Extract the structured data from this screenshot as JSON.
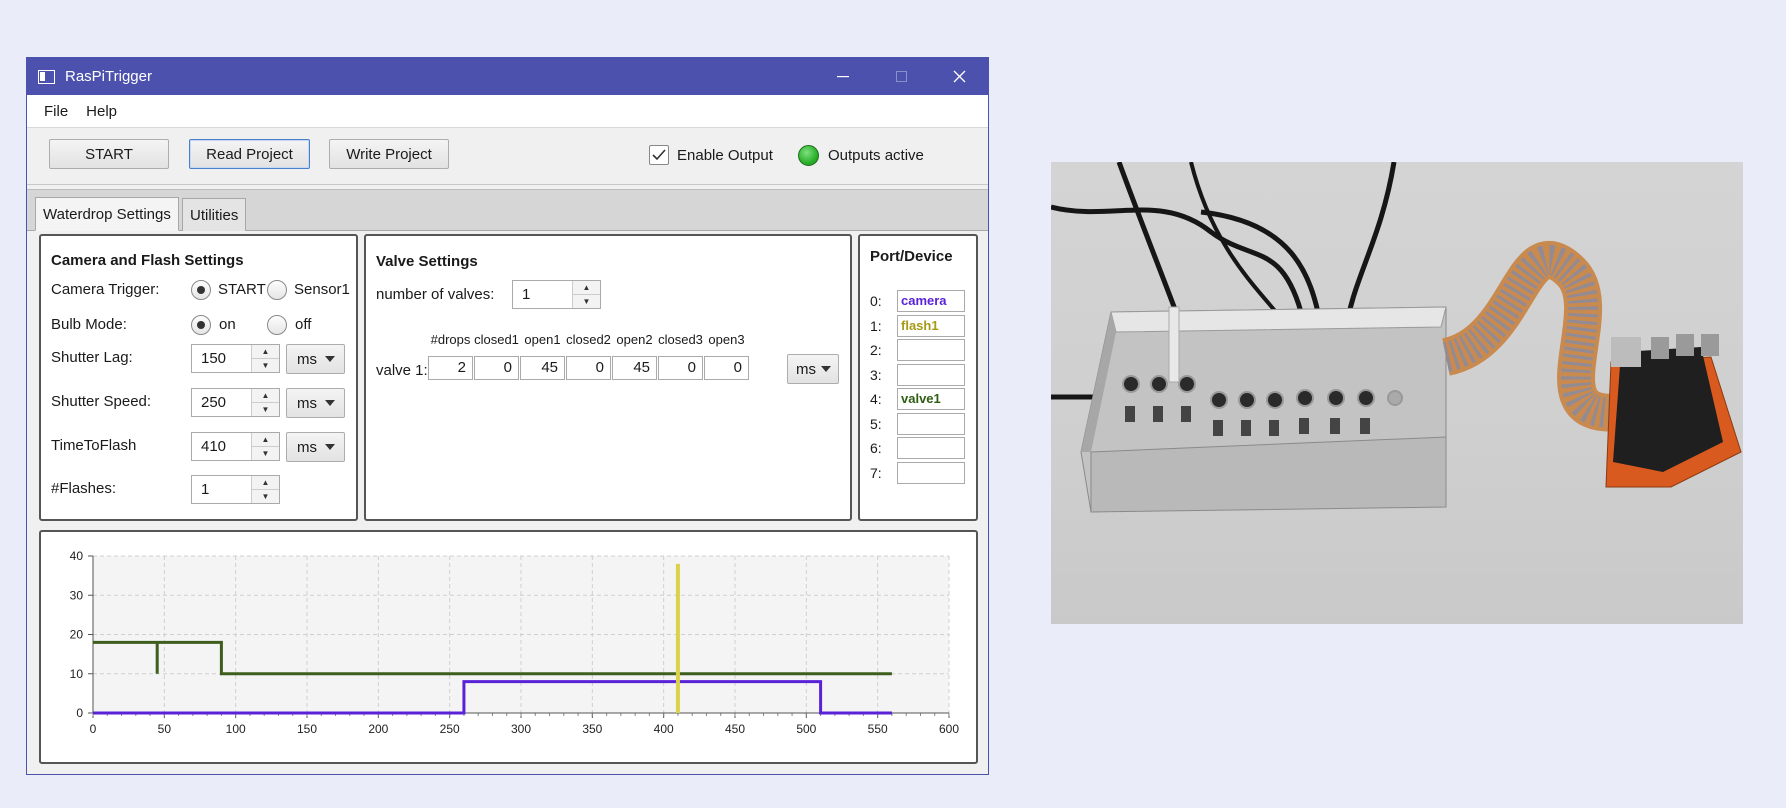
{
  "window": {
    "title": "RasPiTrigger",
    "controls": {
      "minimize": "—",
      "maximize": "☐",
      "close": "✕"
    }
  },
  "menu": [
    "File",
    "Help"
  ],
  "toolbar": {
    "start_label": "START",
    "read_label": "Read Project",
    "write_label": "Write Project",
    "enable_output_label": "Enable Output",
    "enable_output_checked": true,
    "outputs_active_label": "Outputs active",
    "led_color": "#2bb12b"
  },
  "tabs": [
    "Waterdrop Settings",
    "Utilities"
  ],
  "camera": {
    "title": "Camera and Flash Settings",
    "trigger_label": "Camera Trigger:",
    "trigger_options": [
      "START",
      "Sensor1"
    ],
    "trigger_selected": "START",
    "bulb_label": "Bulb Mode:",
    "bulb_options": [
      "on",
      "off"
    ],
    "bulb_selected": "on",
    "shutter_lag_label": "Shutter Lag:",
    "shutter_lag": "150",
    "shutter_lag_unit": "ms",
    "shutter_speed_label": "Shutter Speed:",
    "shutter_speed": "250",
    "shutter_speed_unit": "ms",
    "time_to_flash_label": "TimeToFlash",
    "time_to_flash": "410",
    "time_to_flash_unit": "ms",
    "flashes_label": "#Flashes:",
    "flashes": "1"
  },
  "valve": {
    "title": "Valve Settings",
    "num_label": "number of valves:",
    "num": "1",
    "headers": [
      "#drops",
      "closed1",
      "open1",
      "closed2",
      "open2",
      "closed3",
      "open3"
    ],
    "row_label": "valve 1:",
    "row_values": [
      "2",
      "0",
      "45",
      "0",
      "45",
      "0",
      "0"
    ],
    "unit": "ms"
  },
  "ports": {
    "title": "Port/Device",
    "items": [
      {
        "label": "0:",
        "value": "camera",
        "color": "#5a22d6"
      },
      {
        "label": "1:",
        "value": "flash1",
        "color": "#a79a16"
      },
      {
        "label": "2:",
        "value": "",
        "color": "#000000"
      },
      {
        "label": "3:",
        "value": "",
        "color": "#000000"
      },
      {
        "label": "4:",
        "value": "valve1",
        "color": "#2f5e12"
      },
      {
        "label": "5:",
        "value": "",
        "color": "#000000"
      },
      {
        "label": "6:",
        "value": "",
        "color": "#000000"
      },
      {
        "label": "7:",
        "value": "",
        "color": "#000000"
      }
    ]
  },
  "chart_data": {
    "type": "line",
    "xlim": [
      0,
      600
    ],
    "ylim": [
      0,
      40
    ],
    "xticks": [
      "0",
      "50",
      "100",
      "150",
      "200",
      "250",
      "300",
      "350",
      "400",
      "450",
      "500",
      "550",
      "600"
    ],
    "yticks": [
      "0",
      "10",
      "20",
      "30",
      "40"
    ],
    "grid": true,
    "series": [
      {
        "color": "#3d5e1d",
        "points": [
          [
            0,
            18
          ],
          [
            45,
            18
          ],
          [
            45,
            10
          ],
          [
            45,
            18
          ],
          [
            90,
            18
          ],
          [
            90,
            10
          ],
          [
            560,
            10
          ]
        ]
      },
      {
        "color": "#5a22d6",
        "points": [
          [
            0,
            0
          ],
          [
            260,
            0
          ],
          [
            260,
            8
          ],
          [
            510,
            8
          ],
          [
            510,
            0
          ],
          [
            560,
            0
          ]
        ]
      },
      {
        "color": "#d9d24a",
        "points": [
          [
            410,
            0
          ],
          [
            410,
            38
          ]
        ]
      }
    ]
  }
}
